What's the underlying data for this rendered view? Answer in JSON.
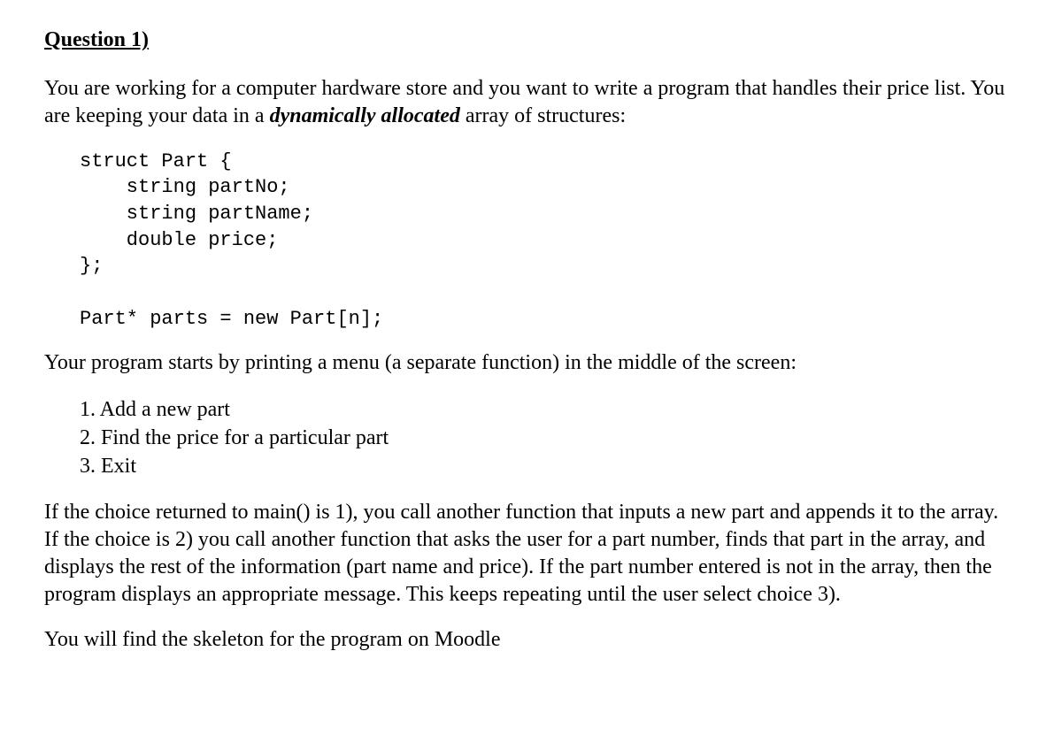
{
  "heading": "Question 1)",
  "para1_pre": "You are working for a computer hardware store and you want to write a program that handles their price list. You are keeping your data in a ",
  "para1_emph": "dynamically allocated",
  "para1_post": " array of structures:",
  "code": "struct Part {\n    string partNo;\n    string partName;\n    double price;\n};\n\nPart* parts = new Part[n];",
  "para2": "Your program starts by printing a menu (a separate function) in the middle of the screen:",
  "menu": {
    "item1": "1. Add a new part",
    "item2": "2. Find the price for a particular part",
    "item3": "3. Exit"
  },
  "para3": "If the choice returned to main() is 1), you call another function that inputs a new part and appends it to the array. If the choice is 2) you call another function that asks the user for a part number, finds that part in the array, and displays the rest of the information (part name and price). If the part number entered is not in the array, then the program displays an appropriate message. This keeps repeating until the user select choice 3).",
  "para4": "You will find the skeleton for the program on Moodle"
}
